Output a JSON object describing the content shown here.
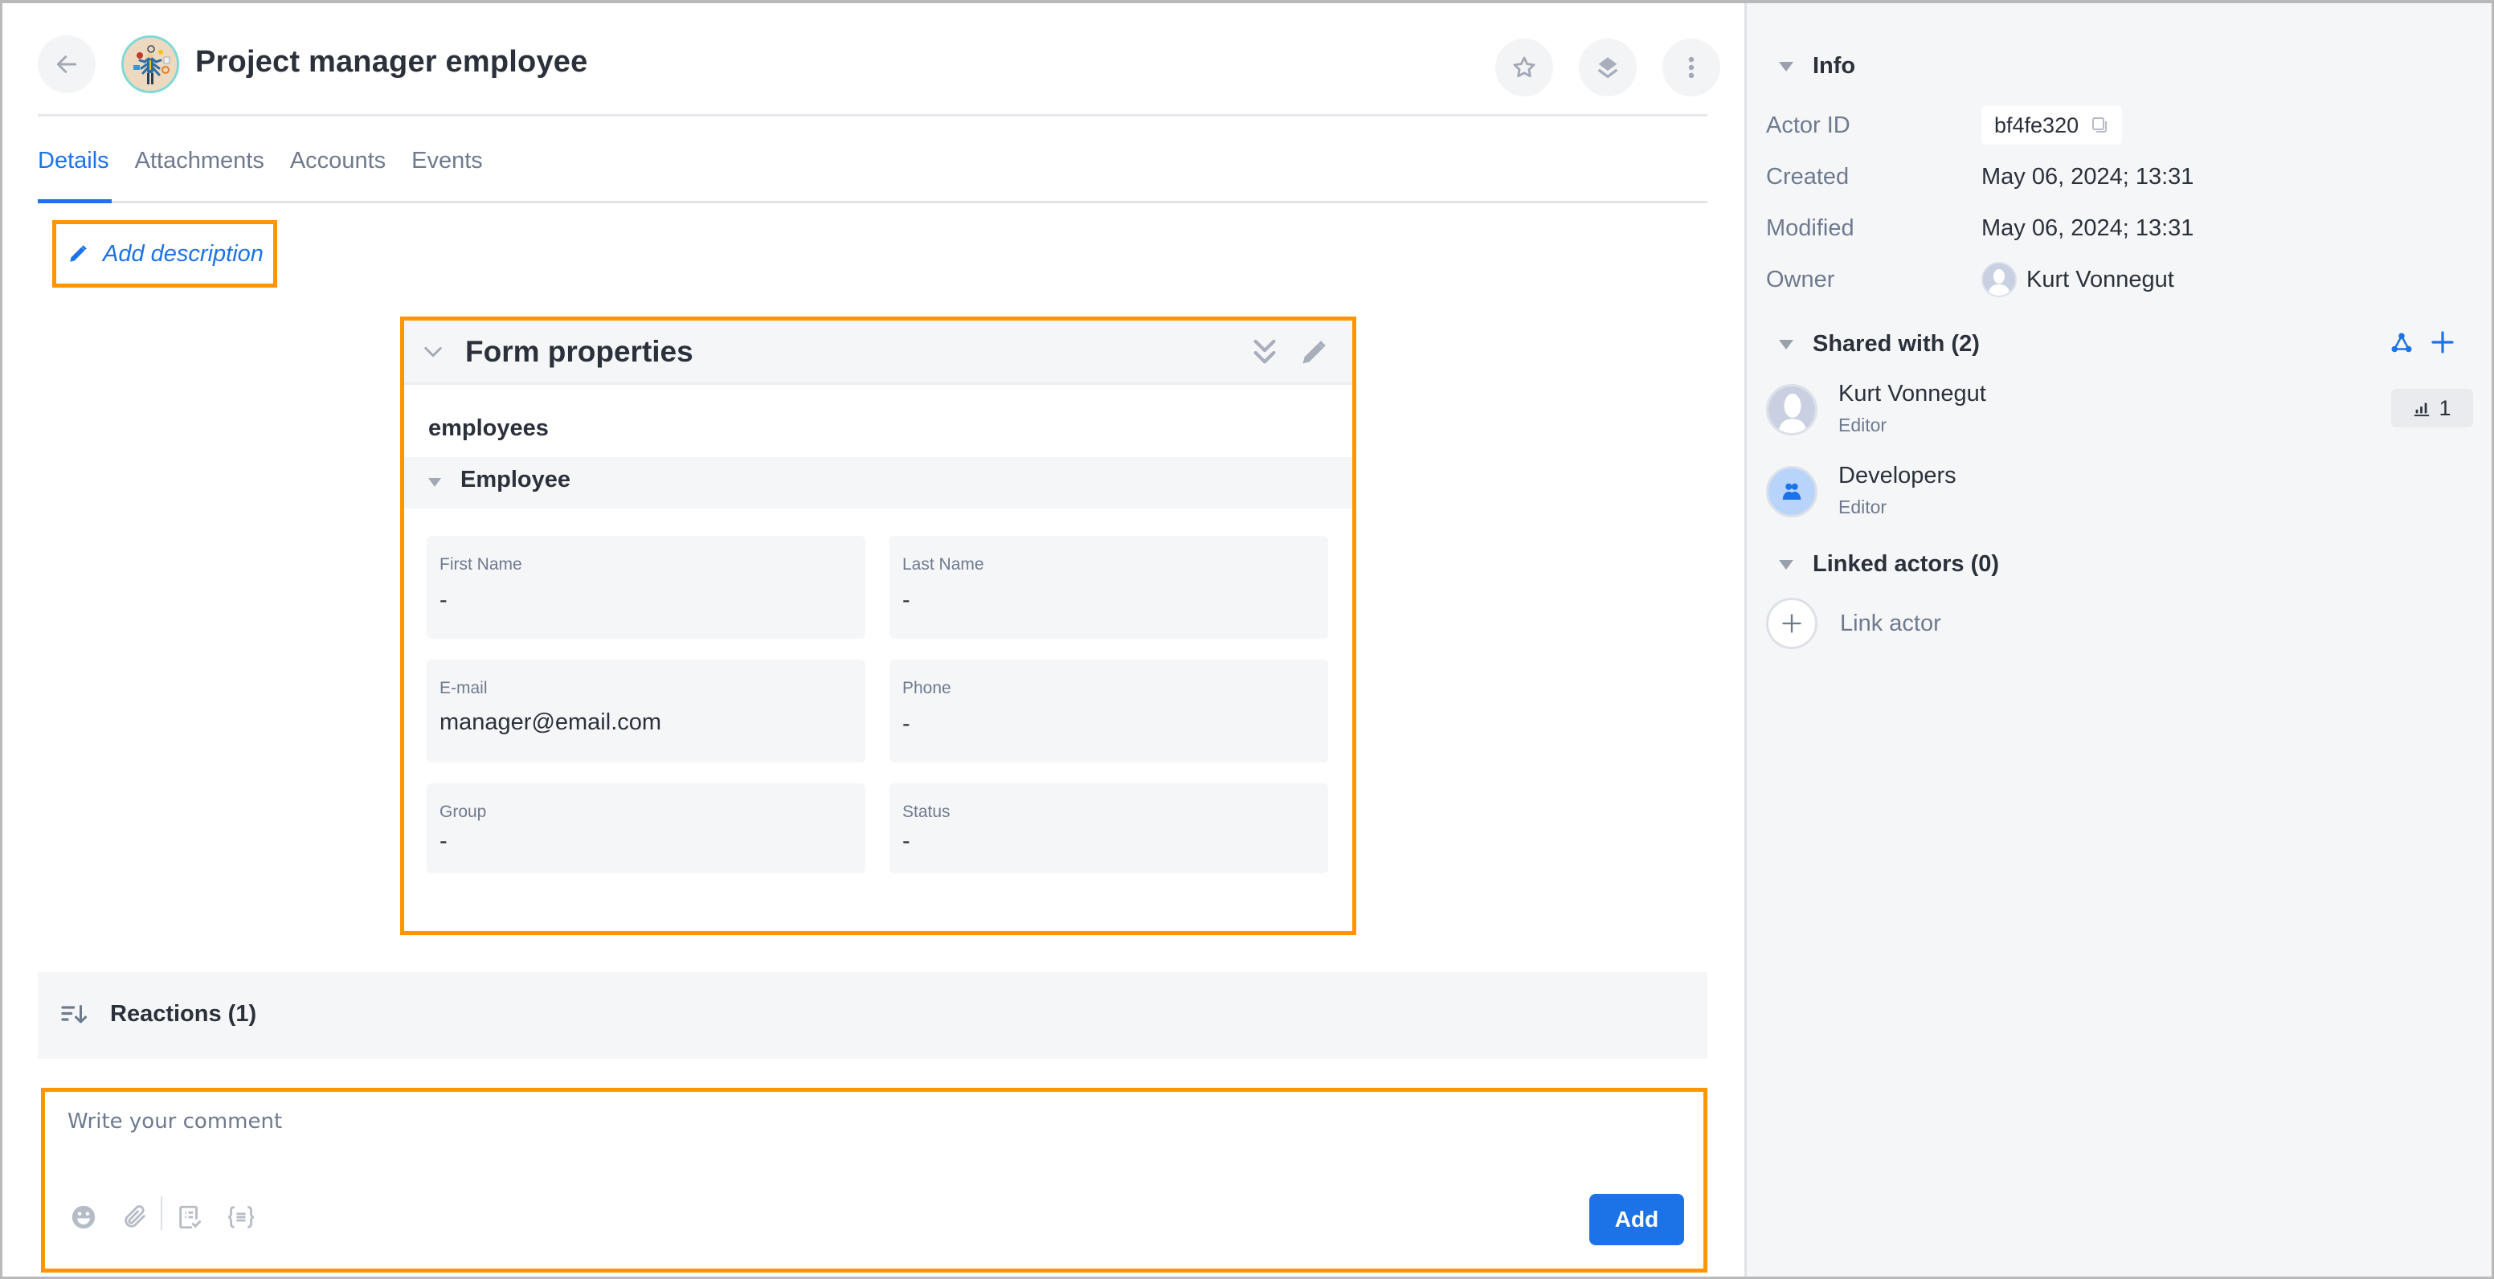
{
  "header": {
    "title": "Project manager employee",
    "back_icon": "arrow-left-icon",
    "avatar": "project-manager-illustration",
    "actions": [
      {
        "name": "favorite",
        "icon": "star-icon"
      },
      {
        "name": "layers",
        "icon": "layers-icon"
      },
      {
        "name": "more",
        "icon": "more-vertical-icon"
      }
    ]
  },
  "tabs": [
    {
      "label": "Details",
      "active": true
    },
    {
      "label": "Attachments",
      "active": false
    },
    {
      "label": "Accounts",
      "active": false
    },
    {
      "label": "Events",
      "active": false
    }
  ],
  "description": {
    "add_label": "Add description",
    "icon": "pencil-icon"
  },
  "form": {
    "title": "Form properties",
    "subtitle": "employees",
    "section": "Employee",
    "fields": [
      {
        "label": "First Name",
        "value": "-"
      },
      {
        "label": "Last Name",
        "value": "-"
      },
      {
        "label": "E-mail",
        "value": "manager@email.com"
      },
      {
        "label": "Phone",
        "value": "-"
      },
      {
        "label": "Group",
        "value": "-"
      },
      {
        "label": "Status",
        "value": "-"
      }
    ]
  },
  "reactions": {
    "label": "Reactions (1)",
    "icon": "sort-descending-icon"
  },
  "comment": {
    "placeholder": "Write your comment",
    "value": "",
    "tools": [
      "emoji-icon",
      "paperclip-icon",
      "checklist-icon",
      "code-braces-icon"
    ],
    "submit_label": "Add"
  },
  "sidebar": {
    "info": {
      "title": "Info",
      "rows": [
        {
          "key": "Actor ID",
          "value": "bf4fe320"
        },
        {
          "key": "Created",
          "value": "May 06, 2024; 13:31"
        },
        {
          "key": "Modified",
          "value": "May 06, 2024; 13:31"
        },
        {
          "key": "Owner",
          "value": "Kurt Vonnegut"
        }
      ]
    },
    "shared": {
      "title": "Shared with (2)",
      "items": [
        {
          "name": "Kurt Vonnegut",
          "role": "Editor",
          "badge": "1",
          "avatar": "user-silhouette"
        },
        {
          "name": "Developers",
          "role": "Editor",
          "avatar": "group-icon"
        }
      ]
    },
    "linked": {
      "title": "Linked actors (0)",
      "add_label": "Link actor"
    }
  },
  "colors": {
    "accent": "#1c73e8",
    "highlight": "#ff9500",
    "muted_text": "#6e7a8e",
    "panel_bg": "#f5f6f8"
  }
}
